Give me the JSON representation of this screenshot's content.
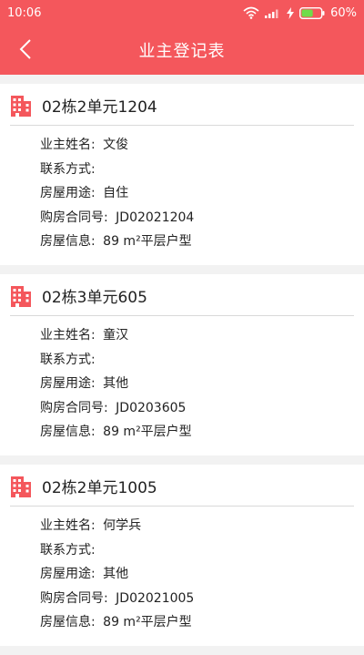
{
  "status_bar": {
    "time": "10:06",
    "battery": "60%",
    "icons": [
      "wifi-icon",
      "signal-icon",
      "charging-icon",
      "battery-icon"
    ]
  },
  "header": {
    "title": "业主登记表",
    "back_icon": "chevron-left-icon"
  },
  "colors": {
    "accent": "#f4575c",
    "icon": "#f4575c",
    "battery_fill": "#6fdc4a"
  },
  "labels": {
    "owner_name": "业主姓名:",
    "contact": "联系方式:",
    "usage": "房屋用途:",
    "contract_no": "购房合同号:",
    "house_info": "房屋信息:"
  },
  "records": [
    {
      "unit": "02栋2单元1204",
      "owner_name": "文俊",
      "contact": "",
      "usage": "自住",
      "contract_no": "JD02021204",
      "house_info": "89 m²平层户型"
    },
    {
      "unit": "02栋3单元605",
      "owner_name": "童汉",
      "contact": "",
      "usage": "其他",
      "contract_no": "JD0203605",
      "house_info": "89 m²平层户型"
    },
    {
      "unit": "02栋2单元1005",
      "owner_name": "何学兵",
      "contact": "",
      "usage": "其他",
      "contract_no": "JD02021005",
      "house_info": "89 m²平层户型"
    }
  ]
}
